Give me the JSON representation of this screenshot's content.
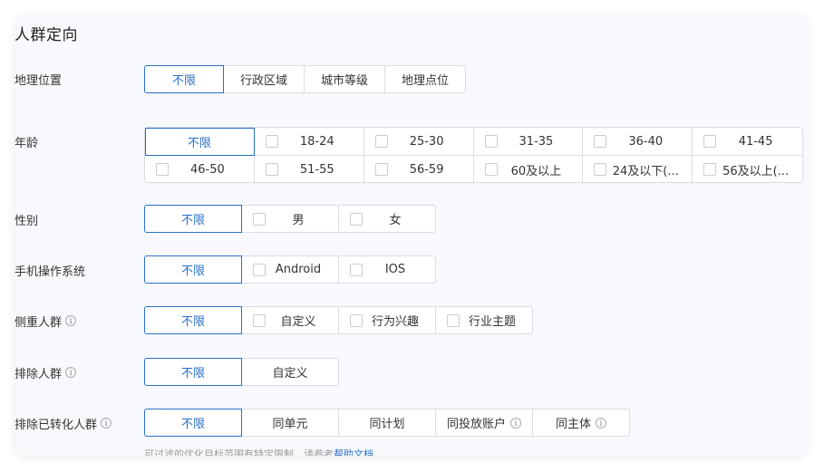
{
  "title": "人群定向",
  "rows": {
    "geo": {
      "label": "地理位置",
      "options": [
        "不限",
        "行政区域",
        "城市等级",
        "地理点位"
      ]
    },
    "age": {
      "label": "年龄",
      "options": [
        "不限",
        "18-24",
        "25-30",
        "31-35",
        "36-40",
        "41-45",
        "46-50",
        "51-55",
        "56-59",
        "60及以上",
        "24及以下(...",
        "56及以上(..."
      ]
    },
    "gender": {
      "label": "性别",
      "options": [
        "不限",
        "男",
        "女"
      ]
    },
    "os": {
      "label": "手机操作系统",
      "options": [
        "不限",
        "Android",
        "IOS"
      ]
    },
    "focus": {
      "label": "侧重人群",
      "options": [
        "不限",
        "自定义",
        "行为兴趣",
        "行业主题"
      ]
    },
    "exclude": {
      "label": "排除人群",
      "options": [
        "不限",
        "自定义"
      ]
    },
    "converted": {
      "label": "排除已转化人群",
      "options": [
        "不限",
        "同单元",
        "同计划",
        "同投放账户",
        "同主体"
      ]
    }
  },
  "hint": {
    "text": "可过滤的优化目标范围有特定限制，请参考",
    "link": "帮助文档"
  },
  "colors": {
    "accent": "#2a6fc9",
    "border": "#d9dde3",
    "card_bg": "#f7f9fc"
  },
  "icons": {
    "info": "info-circle-icon",
    "checkbox": "checkbox-icon"
  }
}
